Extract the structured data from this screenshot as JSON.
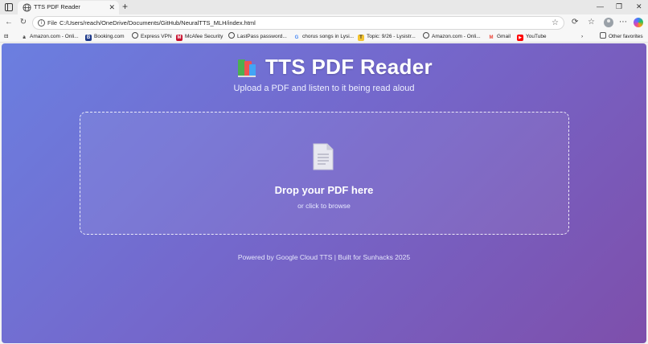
{
  "browser": {
    "tab_title": "TTS PDF Reader",
    "tab_close": "✕",
    "new_tab": "+",
    "window_controls": [
      "—",
      "❐",
      "✕"
    ],
    "address_scheme": "File",
    "address_url": "C:/Users/reach/OneDrive/Documents/GitHub/NeuralTTS_MLH/index.html",
    "bookmarks": [
      {
        "label": "Amazon.com - Onli...",
        "icon": "amazon-icon"
      },
      {
        "label": "Booking.com",
        "icon": "booking-icon"
      },
      {
        "label": "Express VPN",
        "icon": "globe-icon"
      },
      {
        "label": "McAfee Security",
        "icon": "mcafee-icon"
      },
      {
        "label": "LastPass password...",
        "icon": "globe-icon"
      },
      {
        "label": "chorus songs in Lysi...",
        "icon": "google-icon"
      },
      {
        "label": "Topic: 9/26 - Lysistr...",
        "icon": "topic-icon"
      },
      {
        "label": "Amazon.com - Onli...",
        "icon": "globe-icon"
      },
      {
        "label": "Gmail",
        "icon": "gmail-icon"
      },
      {
        "label": "YouTube",
        "icon": "youtube-icon"
      }
    ],
    "other_favorites": "Other favorites"
  },
  "page": {
    "title": "TTS PDF Reader",
    "subtitle": "Upload a PDF and listen to it being read aloud",
    "dropzone": {
      "title": "Drop your PDF here",
      "subtitle": "or click to browse"
    },
    "footer": "Powered by Google Cloud TTS | Built for Sunhacks 2025"
  },
  "colors": {
    "gradient_start": "#6b7fe0",
    "gradient_end": "#7e4fab"
  }
}
